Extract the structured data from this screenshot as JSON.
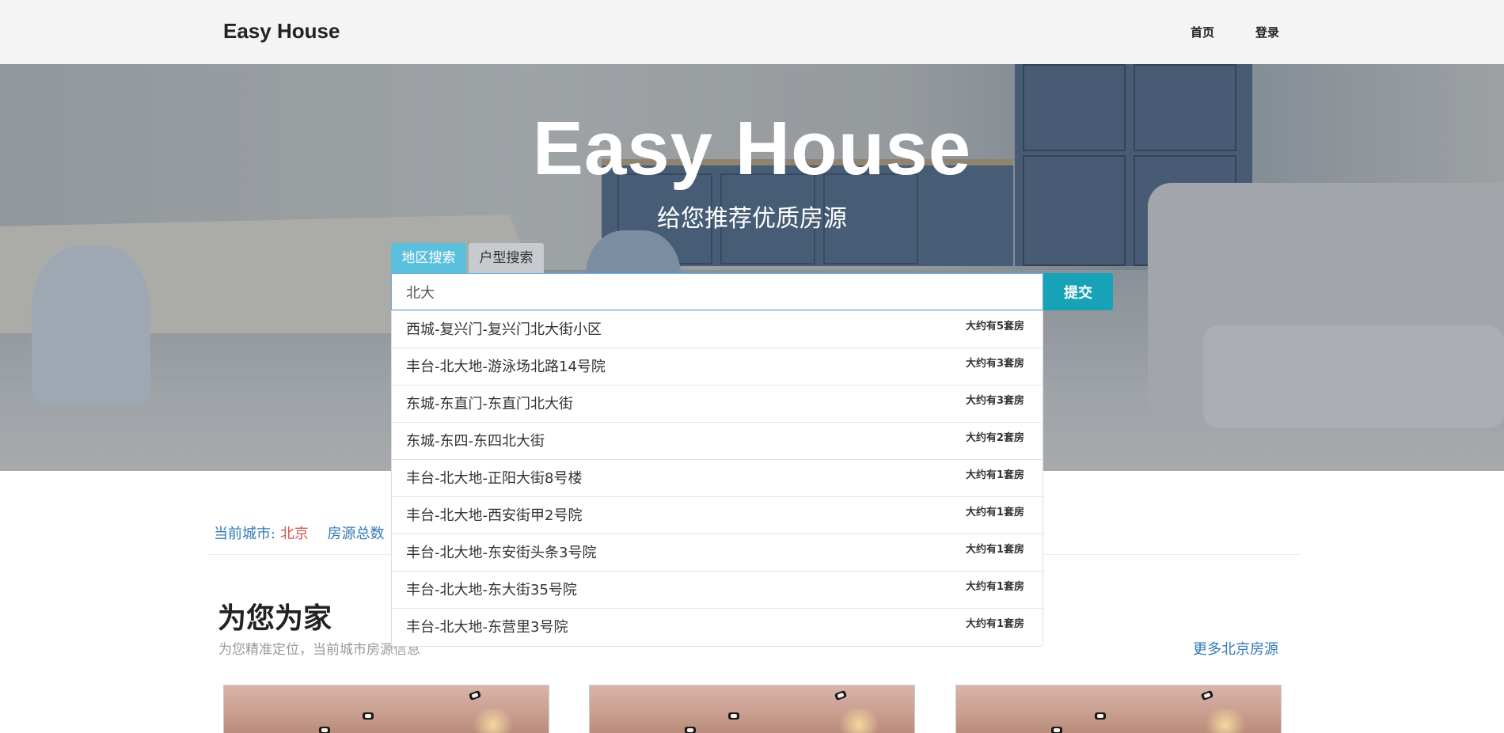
{
  "navbar": {
    "brand": "Easy House",
    "links": {
      "home": "首页",
      "login": "登录"
    }
  },
  "hero": {
    "title": "Easy House",
    "subtitle": "给您推荐优质房源"
  },
  "search": {
    "tabs": {
      "region": "地区搜索",
      "type": "户型搜索"
    },
    "input_value": "北大",
    "submit_label": "提交",
    "suggestions": [
      {
        "name": "西城-复兴门-复兴门北大街小区",
        "count": "大约有5套房"
      },
      {
        "name": "丰台-北大地-游泳场北路14号院",
        "count": "大约有3套房"
      },
      {
        "name": "东城-东直门-东直门北大街",
        "count": "大约有3套房"
      },
      {
        "name": "东城-东四-东四北大街",
        "count": "大约有2套房"
      },
      {
        "name": "丰台-北大地-正阳大街8号楼",
        "count": "大约有1套房"
      },
      {
        "name": "丰台-北大地-西安街甲2号院",
        "count": "大约有1套房"
      },
      {
        "name": "丰台-北大地-东安街头条3号院",
        "count": "大约有1套房"
      },
      {
        "name": "丰台-北大地-东大街35号院",
        "count": "大约有1套房"
      },
      {
        "name": "丰台-北大地-东营里3号院",
        "count": "大约有1套房"
      }
    ]
  },
  "info": {
    "city_label": "当前城市:",
    "city": "北京",
    "total_label": "房源总数"
  },
  "section": {
    "title": "为您为家",
    "subtitle": "为您精准定位，当前城市房源信息",
    "more_link": "更多北京房源"
  },
  "colors": {
    "accent": "#5bc0de",
    "submit": "#17a2b8",
    "link": "#337ab7",
    "city": "#d9534f"
  }
}
